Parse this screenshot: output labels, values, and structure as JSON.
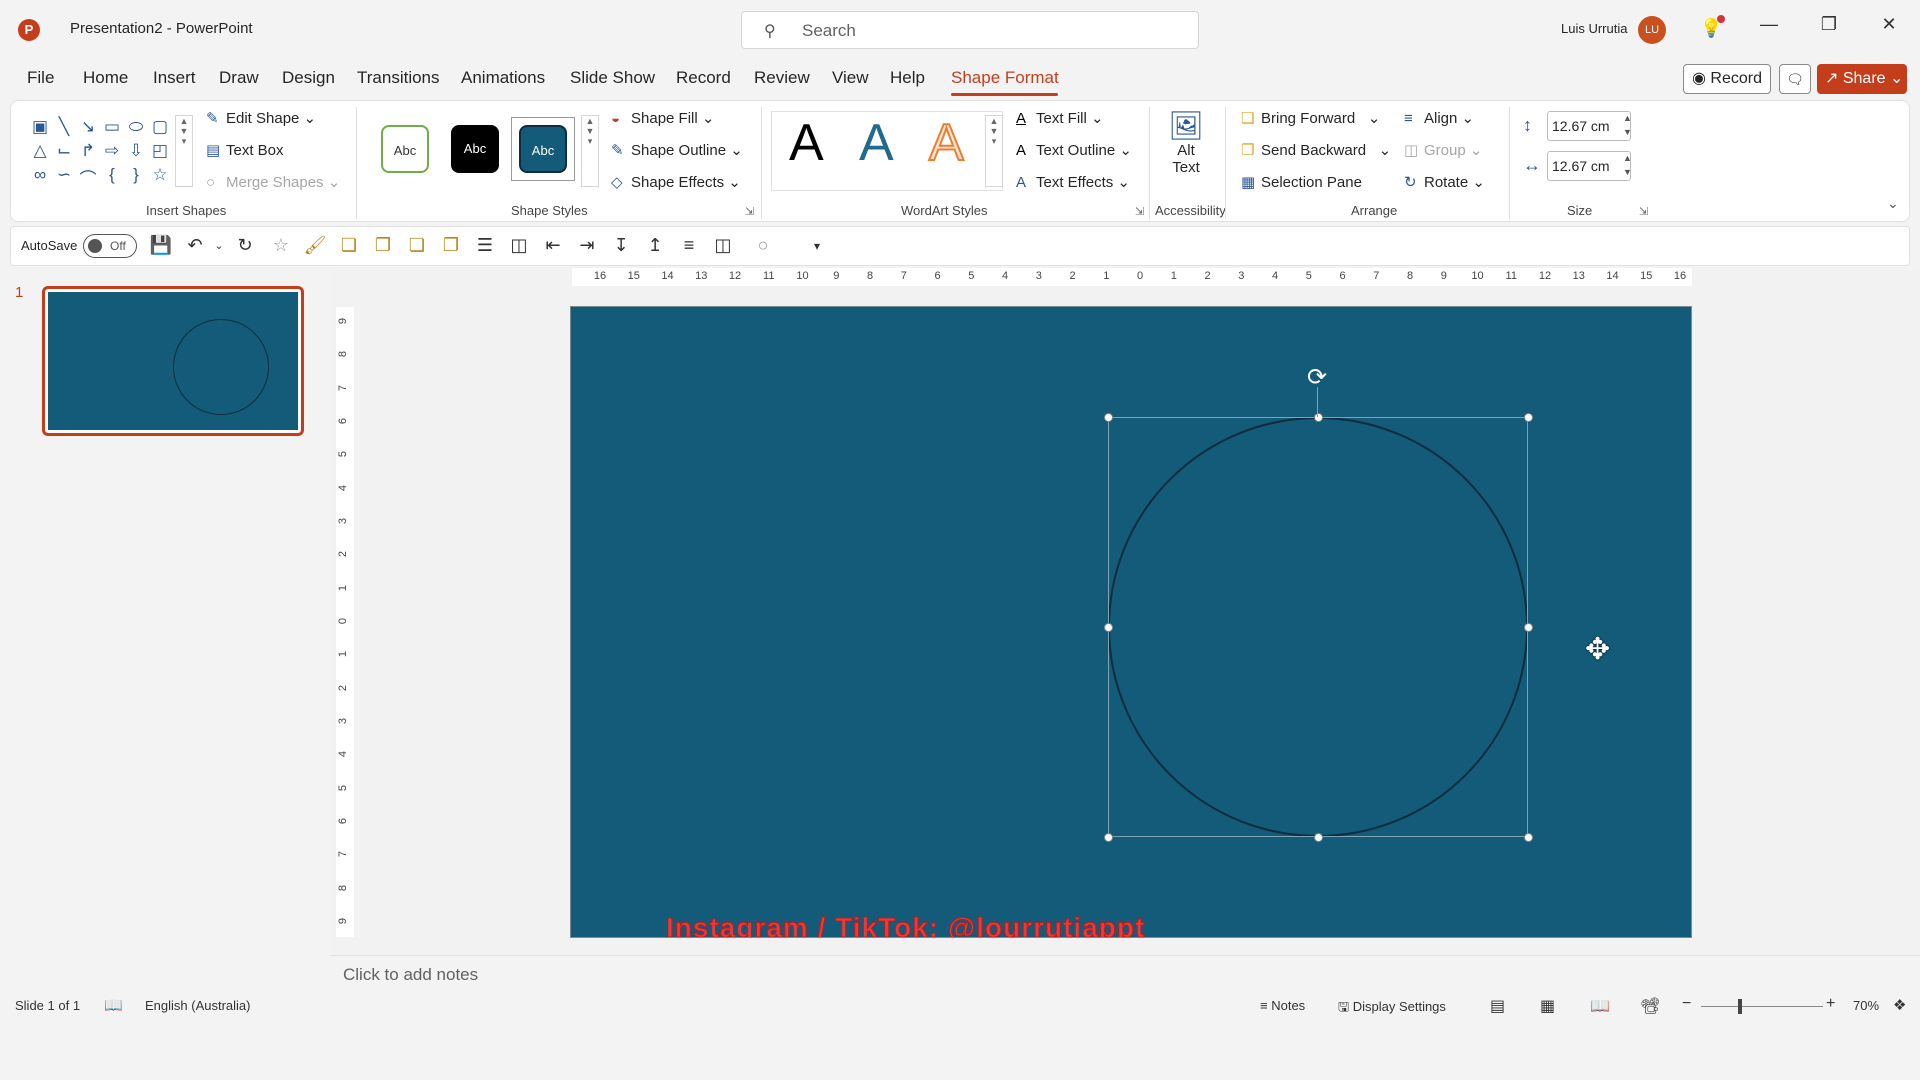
{
  "app": {
    "logo_letter": "P",
    "title": "Presentation2  -  PowerPoint",
    "search_placeholder": "Search",
    "user_name": "Luis Urrutia",
    "user_initials": "LU"
  },
  "menu": {
    "tabs": [
      "File",
      "Home",
      "Insert",
      "Draw",
      "Design",
      "Transitions",
      "Animations",
      "Slide Show",
      "Record",
      "Review",
      "View",
      "Help",
      "Shape Format"
    ],
    "active_tab": "Shape Format",
    "record_label": "Record",
    "share_label": "Share"
  },
  "ribbon": {
    "insert_shapes": {
      "label": "Insert Shapes",
      "edit_shape": "Edit Shape",
      "text_box": "Text Box",
      "merge_shapes": "Merge Shapes"
    },
    "shape_styles": {
      "label": "Shape Styles",
      "swatches": [
        "Abc",
        "Abc",
        "Abc"
      ],
      "shape_fill": "Shape Fill",
      "shape_outline": "Shape Outline",
      "shape_effects": "Shape Effects"
    },
    "wordart": {
      "label": "WordArt Styles",
      "letters": [
        "A",
        "A",
        "A"
      ],
      "text_fill": "Text Fill",
      "text_outline": "Text Outline",
      "text_effects": "Text Effects"
    },
    "accessibility": {
      "label": "Accessibility",
      "alt_text_line1": "Alt",
      "alt_text_line2": "Text"
    },
    "arrange": {
      "label": "Arrange",
      "bring_forward": "Bring Forward",
      "send_backward": "Send Backward",
      "selection_pane": "Selection Pane",
      "align": "Align",
      "group": "Group",
      "rotate": "Rotate"
    },
    "size": {
      "label": "Size",
      "height": "12.67 cm",
      "width": "12.67 cm"
    }
  },
  "qat": {
    "autosave_label": "AutoSave",
    "autosave_state": "Off"
  },
  "thumbnails": {
    "slide_number": "1"
  },
  "ruler": {
    "h_labels": [
      "16",
      "15",
      "14",
      "13",
      "12",
      "11",
      "10",
      "9",
      "8",
      "7",
      "6",
      "5",
      "4",
      "3",
      "2",
      "1",
      "0",
      "1",
      "2",
      "3",
      "4",
      "5",
      "6",
      "7",
      "8",
      "9",
      "10",
      "11",
      "12",
      "13",
      "14",
      "15",
      "16"
    ],
    "v_labels": [
      "9",
      "8",
      "7",
      "6",
      "5",
      "4",
      "3",
      "2",
      "1",
      "0",
      "1",
      "2",
      "3",
      "4",
      "5",
      "6",
      "7",
      "8",
      "9"
    ]
  },
  "slide": {
    "background_color": "#135b78",
    "watermark": "Instagram / TikTok: @lourrutiappt"
  },
  "notes": {
    "placeholder": "Click to add notes"
  },
  "status": {
    "slide_info": "Slide 1 of 1",
    "language": "English (Australia)",
    "notes_label": "Notes",
    "display_settings": "Display Settings",
    "zoom": "70%"
  },
  "colors": {
    "accent": "#c43e1c",
    "slide_bg": "#135b78",
    "circle_outline": "#0e2d40"
  }
}
